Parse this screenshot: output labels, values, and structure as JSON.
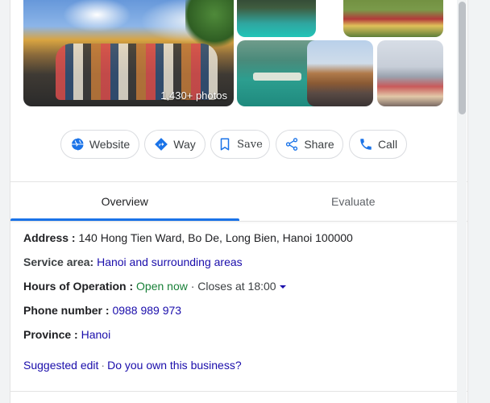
{
  "photos": {
    "count_label": "1,430+ photos"
  },
  "actions": {
    "website": "Website",
    "way": "Way",
    "save": "Save",
    "share": "Share",
    "call": "Call",
    "accent_color": "#1a73e8"
  },
  "tabs": [
    {
      "label": "Overview",
      "active": true
    },
    {
      "label": "Evaluate",
      "active": false
    }
  ],
  "info": {
    "address_label": "Address :",
    "address_value": "140 Hong Tien Ward, Bo De, Long Bien, Hanoi 100000",
    "service_label": "Service area:",
    "service_value": "Hanoi and surrounding areas",
    "hours_label": "Hours of Operation :",
    "hours_status": "Open now",
    "hours_sep": " · ",
    "hours_detail": "Closes at 18:00",
    "phone_label": "Phone number :",
    "phone_value": "0988 989 973",
    "province_label": "Province :",
    "province_value": "Hanoi"
  },
  "footer_links": {
    "suggest_edit": "Suggested edit",
    "separator": "·",
    "own_business": "Do you own this business?"
  }
}
